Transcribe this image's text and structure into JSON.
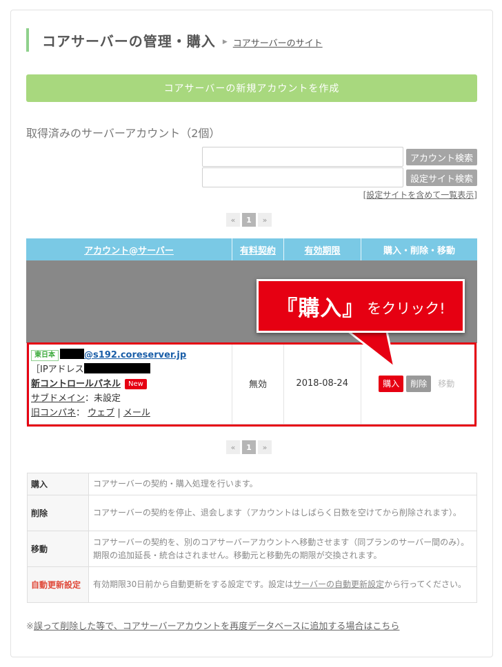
{
  "header": {
    "title": "コアサーバーの管理・購入",
    "site_link": "コアサーバーのサイト"
  },
  "new_account_button": "コアサーバーの新規アカウントを作成",
  "accounts_section_title": "取得済みのサーバーアカウント（2個）",
  "search": {
    "account_value": "",
    "account_button": "アカウント検索",
    "site_value": "",
    "site_button": "設定サイト検索",
    "list_all_link": "[設定サイトを含めて一覧表示]"
  },
  "pager": {
    "prev": "«",
    "page": "1",
    "next": "»"
  },
  "table": {
    "headers": [
      "アカウント@サーバー",
      "有料契約",
      "有効期限",
      "購入・削除・移動"
    ],
    "row": {
      "region": "東日本",
      "account_domain": "@s192.coreserver.jp",
      "ip_prefix": "［IPアドレス",
      "control_panel": "新コントロールパネル",
      "new_badge": "New",
      "subdomain_label": "サブドメイン",
      "subdomain_value": "：未設定",
      "old_panel_label": "旧コンパネ",
      "old_panel_sep": "：",
      "web_link": "ウェブ",
      "pipe": "|",
      "mail_link": "メール",
      "paid": "無効",
      "expiry": "2018-08-24",
      "buy": "購入",
      "delete": "削除",
      "move": "移動"
    }
  },
  "callout": {
    "main": "『購入』",
    "sub": "をクリック!"
  },
  "descriptions": [
    {
      "key": "購入",
      "text": "コアサーバーの契約・購入処理を行います。"
    },
    {
      "key": "削除",
      "text": "コアサーバーの契約を停止、退会します（アカウントはしばらく日数を空けてから削除されます）。"
    },
    {
      "key": "移動",
      "text": "コアサーバーの契約を、別のコアサーバーアカウントへ移動させます（同プランのサーバー間のみ）。期限の追加延長・統合はされません。移動元と移動先の期限が交換されます。"
    },
    {
      "key": "自動更新設定",
      "text_before": "有効期限30日前から自動更新をする設定です。設定は",
      "link": "サーバーの自動更新設定",
      "text_after": "から行ってください。"
    }
  ],
  "footer": {
    "prefix": "※",
    "link": "誤って削除した等で、コアサーバーアカウントを再度データベースに追加する場合はこちら"
  },
  "colors": {
    "accent_green": "#a8d87e",
    "title_bar": "#8fd18c",
    "table_header": "#7ac9e5",
    "highlight_red": "#e60012"
  }
}
